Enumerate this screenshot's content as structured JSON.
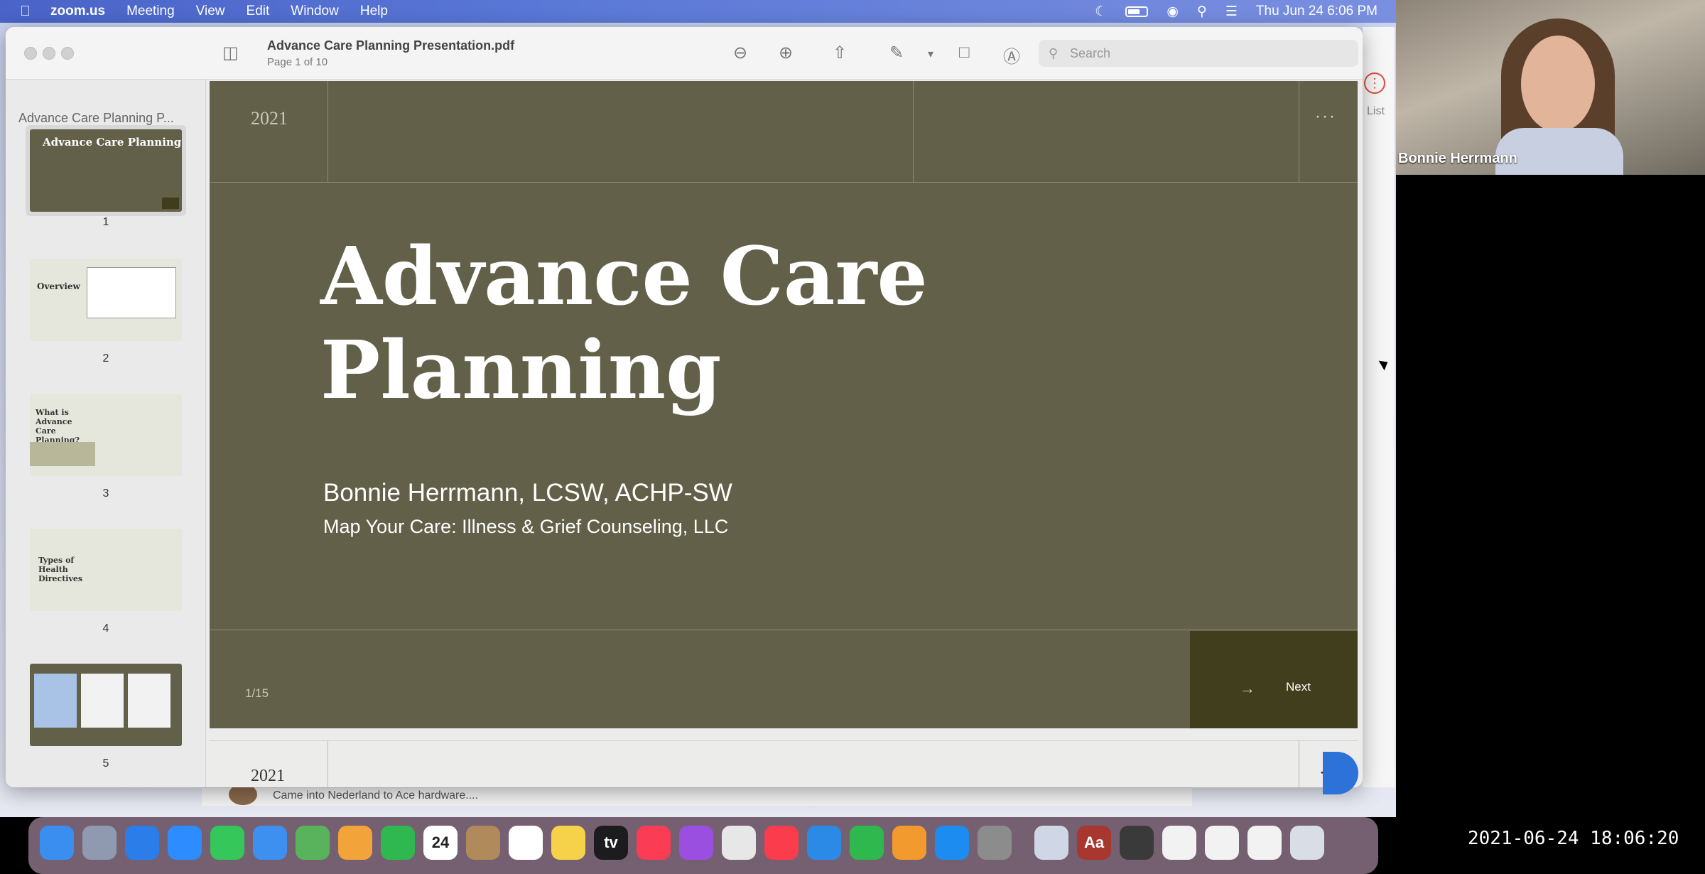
{
  "menubar": {
    "app_name": "zoom.us",
    "items": [
      "Meeting",
      "View",
      "Edit",
      "Window",
      "Help"
    ],
    "clock": "Thu Jun 24  6:06 PM"
  },
  "preview": {
    "doc_title": "Advance Care Planning Presentation.pdf",
    "doc_page": "Page 1 of 10",
    "search_placeholder": "Search",
    "sidebar_title": "Advance Care Planning P...",
    "thumbnails": [
      {
        "label": "1",
        "heading": "Advance Care Planning"
      },
      {
        "label": "2",
        "heading": "Overview"
      },
      {
        "label": "3",
        "heading": "What is Advance Care Planning?"
      },
      {
        "label": "4",
        "heading": "Types of Health Directives"
      },
      {
        "label": "5",
        "heading": ""
      }
    ]
  },
  "slide": {
    "year": "2021",
    "title_line1": "Advance Care",
    "title_line2": "Planning",
    "author": "Bonnie Herrmann, LCSW, ACHP-SW",
    "org": "Map Your Care: Illness & Grief Counseling, LLC",
    "page_indicator": "1/15",
    "next_arrow": "→",
    "next_label": "Next",
    "menu_dots": "···"
  },
  "slide2": {
    "year": "2021",
    "menu_dots": "···"
  },
  "chat": {
    "text": "Came into Nederland to Ace hardware...."
  },
  "webcam": {
    "name": "Bonnie Herrmann"
  },
  "recording": {
    "timestamp": "2021-06-24  18:06:20"
  },
  "right_strip": {
    "label": "List"
  },
  "dock": {
    "items": [
      {
        "name": "finder",
        "color": "#3a8ef0"
      },
      {
        "name": "launchpad",
        "color": "#8f9ab0"
      },
      {
        "name": "safari",
        "color": "#2b7de9"
      },
      {
        "name": "zoom",
        "color": "#2d8cff"
      },
      {
        "name": "messages",
        "color": "#35c759"
      },
      {
        "name": "mail",
        "color": "#3d8ff0"
      },
      {
        "name": "maps",
        "color": "#59b35d"
      },
      {
        "name": "photos",
        "color": "#f2a33a"
      },
      {
        "name": "facetime",
        "color": "#2fb84f"
      },
      {
        "name": "calendar",
        "color": "#ffffff",
        "text": "24"
      },
      {
        "name": "contacts",
        "color": "#b08a5a"
      },
      {
        "name": "reminders",
        "color": "#ffffff"
      },
      {
        "name": "notes",
        "color": "#f6d24a"
      },
      {
        "name": "tv",
        "color": "#1c1c1e",
        "text": "tv"
      },
      {
        "name": "music",
        "color": "#fa3c55"
      },
      {
        "name": "podcasts",
        "color": "#9a4fe0"
      },
      {
        "name": "chrome",
        "color": "#e7e7e7"
      },
      {
        "name": "news",
        "color": "#fa3c4c"
      },
      {
        "name": "keynote",
        "color": "#2b8ae6"
      },
      {
        "name": "numbers",
        "color": "#2eb84d"
      },
      {
        "name": "pages",
        "color": "#f29a2e"
      },
      {
        "name": "app-store",
        "color": "#1d8cf0"
      },
      {
        "name": "system-preferences",
        "color": "#8c8c8c"
      },
      {
        "name": "preview",
        "color": "#cfd6e6"
      },
      {
        "name": "dictionary",
        "color": "#a8372f",
        "text": "Aa"
      },
      {
        "name": "calculator",
        "color": "#3a3a3a"
      },
      {
        "name": "document-1",
        "color": "#f2f2f2"
      },
      {
        "name": "document-2",
        "color": "#f2f2f2"
      },
      {
        "name": "document-3",
        "color": "#f2f2f2"
      },
      {
        "name": "trash",
        "color": "#d8dde6"
      }
    ]
  }
}
